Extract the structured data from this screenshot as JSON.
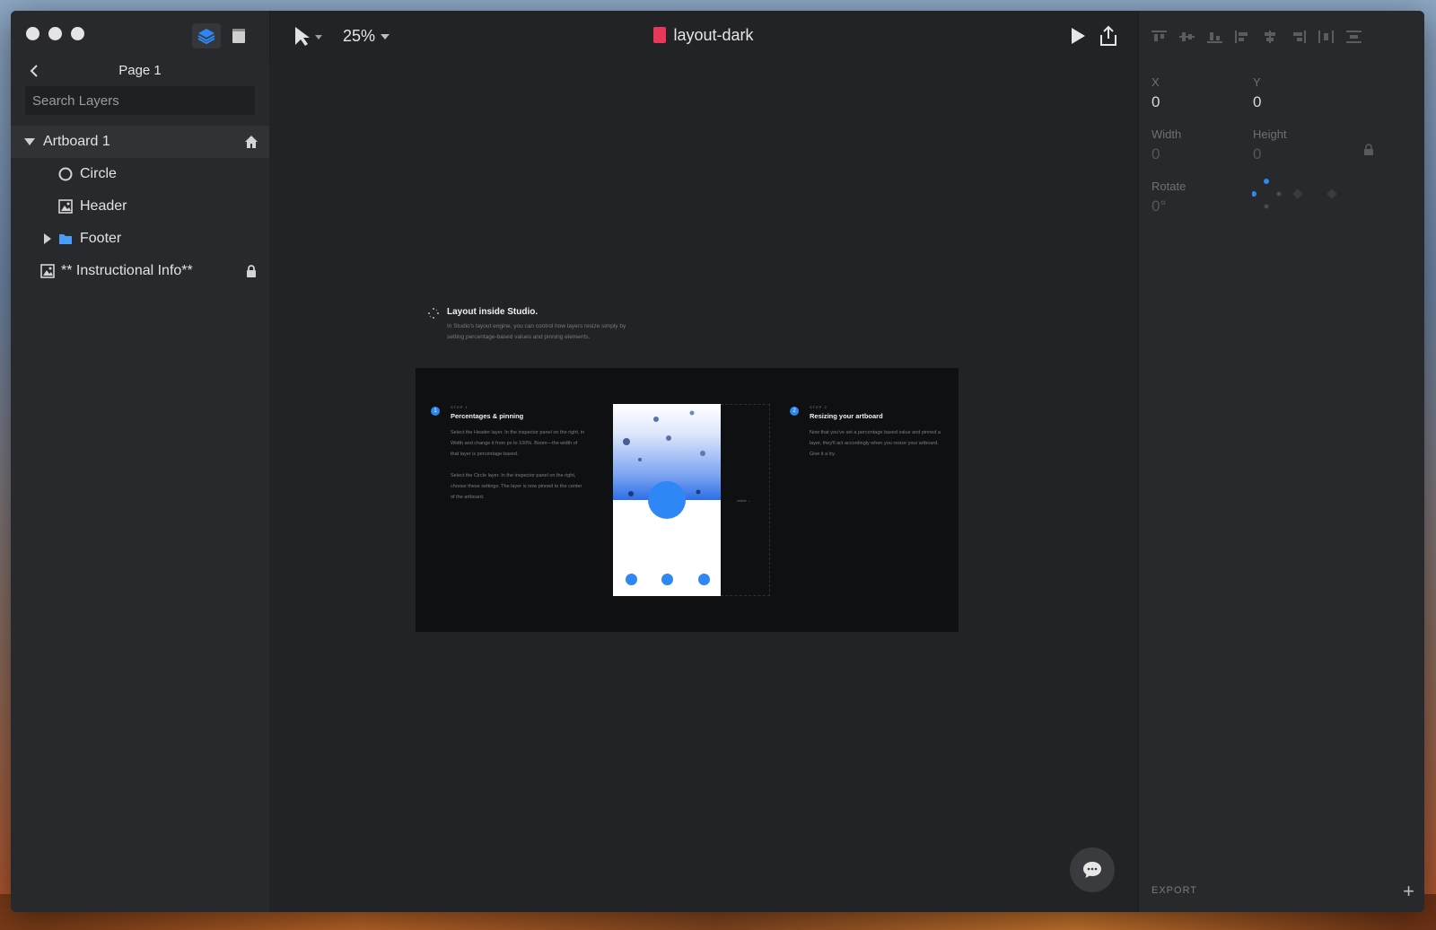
{
  "window": {
    "traffic_lights": [
      "close",
      "minimize",
      "maximize"
    ]
  },
  "left_panel": {
    "tabs": [
      {
        "icon": "layers-icon",
        "active": true
      },
      {
        "icon": "document-icon",
        "active": false
      }
    ],
    "page_title": "Page 1",
    "search_placeholder": "Search Layers",
    "layers": [
      {
        "label": "Artboard 1",
        "icon": "triangle-down",
        "selected": true,
        "trailing": "home-icon"
      },
      {
        "label": "Circle",
        "icon": "circle-icon"
      },
      {
        "label": "Header",
        "icon": "image-icon"
      },
      {
        "label": "Footer",
        "icon": "folder-icon",
        "expander": "triangle-right"
      },
      {
        "label": "** Instructional Info**",
        "icon": "image-icon",
        "trailing": "lock-icon"
      }
    ]
  },
  "toolbar": {
    "zoom": "25%",
    "doc_title": "layout-dark",
    "colors": {
      "doc_icon": "#e8385a"
    }
  },
  "canvas": {
    "intro_title": "Layout inside Studio.",
    "intro_body": "In Studio's layout engine, you can control how layers resize simply by setting percentage-based values and pinning elements.",
    "step1": {
      "num": "1",
      "kicker": "STEP 1",
      "title": "Percentages & pinning",
      "body1": "Select the Header layer. In the inspector panel on the right, in Width and change it from px to 100%. Boom—the width of that layer is percentage-based.",
      "body2": "Select the Circle layer. In the inspector panel on the right, choose these settings. The layer is now pinned to the center of the artboard."
    },
    "step2": {
      "num": "2",
      "kicker": "STEP 2",
      "title": "Resizing your artboard",
      "body": "Now that you've set a percentage based value and pinned a layer, they'll act accordingly when you resize your artboard. Give it a try."
    },
    "resize_label": "resize →",
    "accent": "#2f86f5"
  },
  "inspector": {
    "x_label": "X",
    "x_value": "0",
    "y_label": "Y",
    "y_value": "0",
    "width_label": "Width",
    "width_value": "0",
    "height_label": "Height",
    "height_value": "0",
    "rotate_label": "Rotate",
    "rotate_value": "0°",
    "export_label": "EXPORT",
    "export_add": "+"
  }
}
